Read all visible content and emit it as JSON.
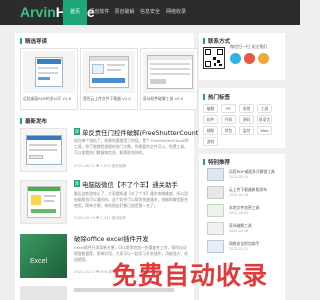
{
  "header": {
    "logo_brand": "Arvin",
    "logo_home": "Home",
    "nav": [
      "首页",
      "原创软件",
      "原创破解",
      "信息安全",
      "网络收录"
    ]
  },
  "featured": {
    "title": "精选导读",
    "items": [
      {
        "caption": "远程桌面RDP的多公开 V1.6"
      },
      {
        "caption": "宽恒云上传文件下载器 V2.0"
      },
      {
        "caption": "豪冰软件破解工具 V3.0"
      }
    ]
  },
  "latest": {
    "title": "最新发布",
    "posts": [
      {
        "badge": "荐",
        "title": "单反责任门控件破解(FreeShutterCount)",
        "excerpt": "现在单个相机了，如果你要使用了的话。是个 FreeShutterCount的工具，除了能够检测相机快门次数。你需要的文件可以，免费工具，可以查看快门数量和信息，能帮助到你的。",
        "meta": "2021-06-21  ♥ 1,023  原创破解"
      },
      {
        "badge": "荐",
        "title": "电脑版微信【不了个羊】通关助手",
        "excerpt": "最近这款游戏火了，大家都知道【羊了个羊】通关攻略难度，所以用电脑版也可以通关的，这个软件可以帮你快速通关，电脑和微信配合使用，简单方便，你的朋友们都已经是第一名了。",
        "meta": "2022-09-19  ♥ 2,341  原创软件"
      },
      {
        "badge": "",
        "title": "破除office excel插件开发",
        "excerpt": "Excel插件开发简单方便，可以帮你完成一些重复性工作，帮你自动提取数据等，简单好用，大家可以一起学习开发插件，功能强大，欢迎使用。",
        "meta": "2021-04-12  ♥ 856  原创软件"
      }
    ]
  },
  "contact": {
    "title": "联系方式",
    "qr_text": "微信扫一扫 关注我们"
  },
  "tags": {
    "title": "热门标签",
    "items": [
      "破解",
      "PE",
      "系统",
      "工具",
      "软件",
      "代码",
      "源码",
      "易语言",
      "辅助",
      "抓包",
      "监控",
      "Web",
      "游戏"
    ]
  },
  "recommend": {
    "title": "特别推荐",
    "items": [
      {
        "title": "远程RDP桌面多开解锁工具",
        "date": "2022-05-10"
      },
      {
        "title": "云上传下载器新版发布",
        "date": "2022-04-28"
      },
      {
        "title": "本地文件加密工具",
        "date": "2022-04-02"
      },
      {
        "title": "豪冰破解工具",
        "date": "2022-03-18"
      },
      {
        "title": "网络安全抓包助手",
        "date": "2022-02-27"
      }
    ]
  },
  "watermark": "免费自动收录",
  "colors": {
    "accent": "#1da777",
    "header": "#2c2c2c",
    "watermark": "#e23a3a"
  }
}
